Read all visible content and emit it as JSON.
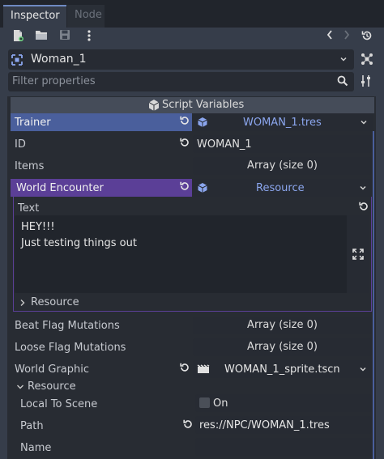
{
  "tabs": [
    {
      "label": "Inspector",
      "active": true
    },
    {
      "label": "Node",
      "active": false
    }
  ],
  "object": {
    "name": "Woman_1"
  },
  "filter": {
    "placeholder": "Filter properties"
  },
  "section": {
    "title": "Script Variables"
  },
  "trainer": {
    "label": "Trainer",
    "value": "WOMAN_1.tres"
  },
  "id": {
    "label": "ID",
    "value": "WOMAN_1"
  },
  "items": {
    "label": "Items",
    "value": "Array (size 0)"
  },
  "world_encounter": {
    "label": "World Encounter",
    "value": "Resource",
    "text_label": "Text",
    "text_lines": [
      "HEY!!!",
      "Just testing things out"
    ],
    "resource_label": "Resource"
  },
  "beat_flag": {
    "label": "Beat Flag Mutations",
    "value": "Array (size 0)"
  },
  "loose_flag": {
    "label": "Loose Flag Mutations",
    "value": "Array (size 0)"
  },
  "world_graphic": {
    "label": "World Graphic",
    "value": "WOMAN_1_sprite.tscn"
  },
  "resource_group": {
    "label": "Resource",
    "local_to_scene": {
      "label": "Local To Scene",
      "value": "On"
    },
    "path": {
      "label": "Path",
      "value": "res://NPC/WOMAN_1.tres"
    },
    "name": {
      "label": "Name",
      "value": ""
    }
  },
  "colors": {
    "accent": "#6f8ac2",
    "trainer_row": "#4a5f9c",
    "encounter_row": "#5b3f97"
  }
}
